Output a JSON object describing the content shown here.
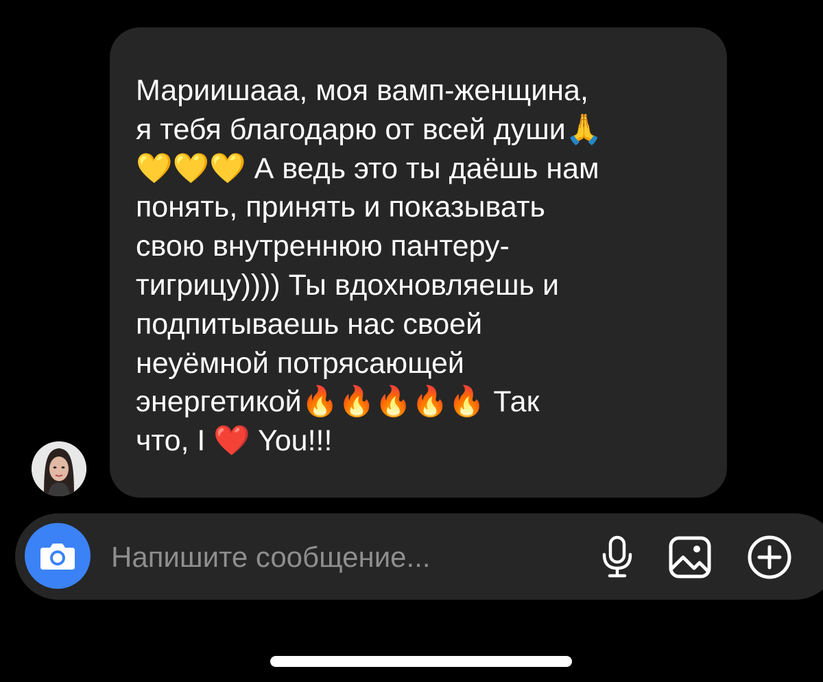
{
  "message": {
    "text": "Мариишааа, моя вамп-женщина,\nя тебя благодарю от всей души🙏\n💛💛💛 А ведь это ты даёшь нам\nпонять, принять и показывать\nсвою внутреннюю пантеру-\nтигрицу))))  Ты вдохновляешь и\nподпитываешь нас своей\nнеуёмной потрясающей\nэнергетикой🔥🔥🔥🔥🔥 Так\nчто, I ❤️ You!!!"
  },
  "avatar": {
    "icon": "user-avatar-photo"
  },
  "composer": {
    "placeholder": "Напишите сообщение...",
    "camera_icon": "camera-icon",
    "mic_icon": "microphone-icon",
    "gallery_icon": "gallery-icon",
    "plus_icon": "plus-circle-icon",
    "accent_color": "#3b82f6"
  }
}
